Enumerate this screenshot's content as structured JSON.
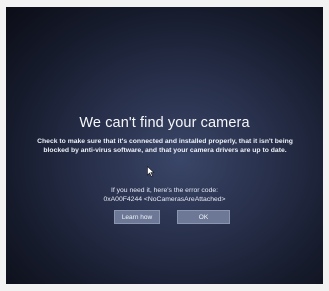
{
  "dialog": {
    "title": "We can't find your camera",
    "message": "Check to make sure that it's connected and installed properly, that it isn't being blocked by anti-virus software, and that your camera drivers are up to date.",
    "error_intro": "If you need it, here's the error code:",
    "error_code": "0xA00F4244 <NoCamerasAreAttached>",
    "learn_how_label": "Learn how",
    "ok_label": "OK"
  },
  "colors": {
    "screen_background": "#1c2238",
    "button_fill": "#6d7896",
    "text": "#f3f5fa"
  },
  "icons": {
    "cursor": "mouse-pointer-icon"
  }
}
